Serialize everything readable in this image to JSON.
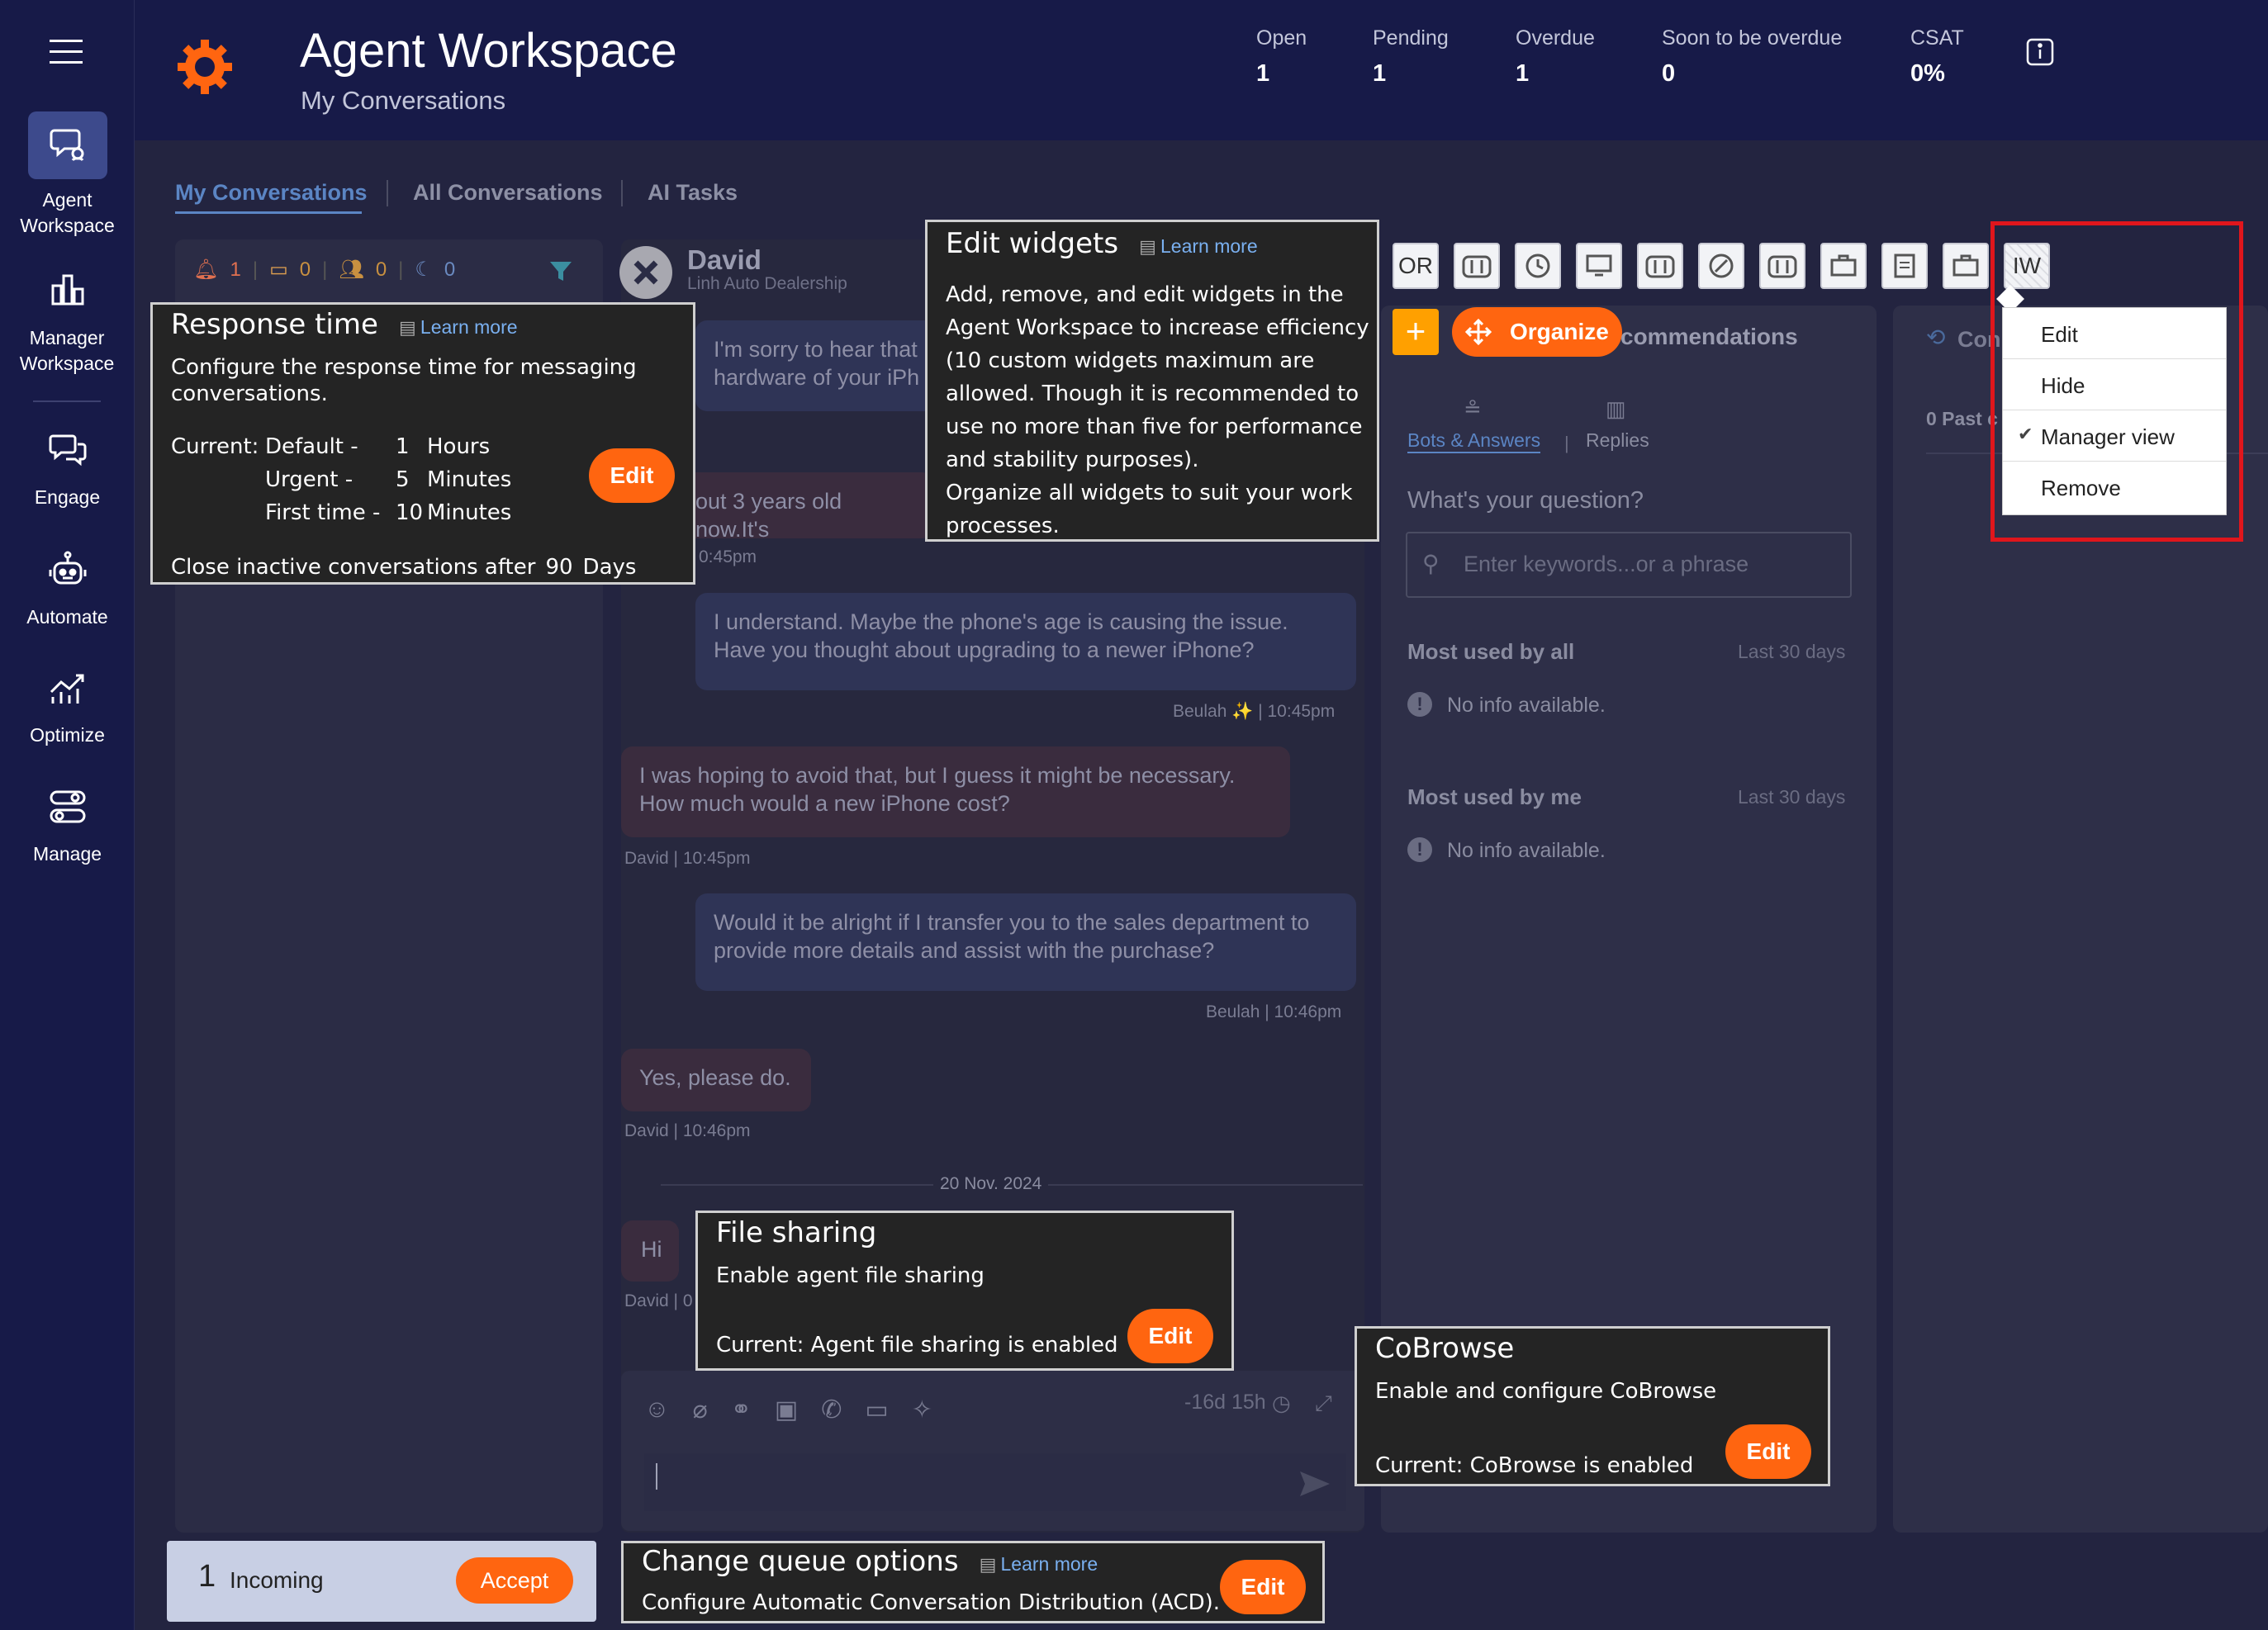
{
  "app": {
    "title": "Agent Workspace",
    "subtitle": "My Conversations"
  },
  "sidebar": {
    "items": [
      {
        "label": "Agent Workspace",
        "icon": "headset-chat-icon"
      },
      {
        "label": "Manager Workspace",
        "icon": "bar-chart-icon"
      },
      {
        "label": "Engage",
        "icon": "chat-bubbles-icon"
      },
      {
        "label": "Automate",
        "icon": "robot-icon"
      },
      {
        "label": "Optimize",
        "icon": "trend-chart-icon"
      },
      {
        "label": "Manage",
        "icon": "toggles-icon"
      }
    ]
  },
  "kpis": [
    {
      "label": "Open",
      "value": "1"
    },
    {
      "label": "Pending",
      "value": "1"
    },
    {
      "label": "Overdue",
      "value": "1"
    },
    {
      "label": "Soon to be overdue",
      "value": "0"
    },
    {
      "label": "CSAT",
      "value": "0%"
    }
  ],
  "tabs": [
    {
      "label": "My Conversations"
    },
    {
      "label": "All Conversations"
    },
    {
      "label": "AI Tasks"
    }
  ],
  "filters": {
    "alerts": "1",
    "messages": "0",
    "users": "0",
    "away": "0"
  },
  "conversation": {
    "name": "David",
    "company": "Linh Auto Dealership"
  },
  "messages": [
    {
      "text": "I'm sorry to hear that",
      "text2": "hardware of your iPh"
    },
    {
      "text": "out 3 years old now.It's"
    },
    {
      "meta": "0:45pm"
    },
    {
      "text": "I understand. Maybe the phone's age is causing the issue.",
      "text2": "Have you thought about upgrading to a newer iPhone?",
      "meta": "Beulah ✨ | 10:45pm"
    },
    {
      "text": "I was hoping to avoid that, but I guess it might be necessary.",
      "text2": "How much would a new iPhone cost?",
      "meta": "David | 10:45pm"
    },
    {
      "text": "Would it be alright if I transfer you to the sales department to",
      "text2": "provide more details and assist with the purchase?",
      "meta": "Beulah | 10:46pm"
    },
    {
      "text": "Yes, please do.",
      "meta": "David | 10:46pm"
    },
    {
      "date": "20 Nov. 2024"
    },
    {
      "text": "Hi",
      "meta": "David | 0"
    }
  ],
  "composer": {
    "timer": "-16d 15h"
  },
  "incoming": {
    "count": "1",
    "label": "Incoming",
    "accept": "Accept"
  },
  "widgets": {
    "or_label": "OR",
    "iw_label": "IW",
    "organize": "Organize",
    "recommendations": "commendations",
    "subtabs": [
      "Bots & Answers",
      "Replies"
    ],
    "question": "What's your question?",
    "search_placeholder": "Enter keywords...or a phrase",
    "most_used_all": "Most used by all",
    "most_used_me": "Most used by me",
    "last30": "Last 30 days",
    "noinfo": "No info available.",
    "past": "0 Past c",
    "con": "Con"
  },
  "menu": {
    "items": [
      "Edit",
      "Hide",
      "Manager view",
      "Remove"
    ]
  },
  "callouts": {
    "response": {
      "title": "Response time",
      "learn": "Learn more",
      "body": "Configure the response time for messaging",
      "body2": "conversations.",
      "current": "Current:",
      "r1": "Default -",
      "r1n": "1",
      "r1u": "Hours",
      "r2": "Urgent -",
      "r2n": "5",
      "r2u": "Minutes",
      "r3": "First time -",
      "r3n": "10",
      "r3u": "Minutes",
      "close": "Close inactive conversations after",
      "closen": "90",
      "closeu": "Days",
      "edit": "Edit"
    },
    "widgets": {
      "title": "Edit widgets",
      "learn": "Learn more",
      "lines": [
        "Add, remove, and edit widgets in the",
        "Agent Workspace to increase efficiency",
        "(10 custom widgets maximum are",
        "allowed. Though it is recommended to",
        "use no more than five for performance",
        "and stability purposes).",
        "Organize all widgets to suit your work",
        "processes."
      ]
    },
    "file": {
      "title": "File sharing",
      "body": "Enable agent file sharing",
      "current": "Current: Agent file sharing is enabled",
      "edit": "Edit"
    },
    "cobrowse": {
      "title": "CoBrowse",
      "body": "Enable and configure CoBrowse",
      "current": "Current: CoBrowse is enabled",
      "edit": "Edit"
    },
    "queue": {
      "title": "Change queue options",
      "learn": "Learn more",
      "body": "Configure Automatic Conversation Distribution (ACD).",
      "edit": "Edit"
    }
  },
  "colors": {
    "accent": "#ff6510",
    "sidebar": "#171a48",
    "highlight": "#e0161c"
  }
}
